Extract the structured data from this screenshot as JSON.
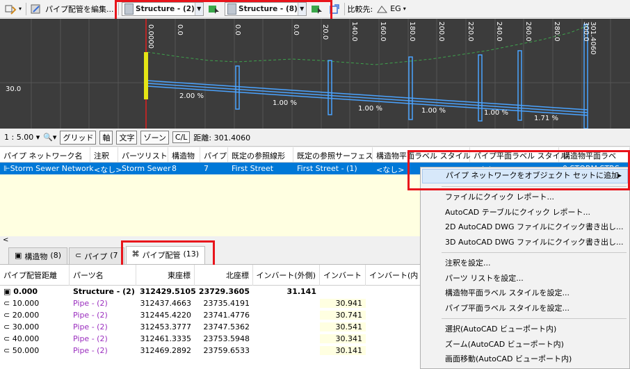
{
  "toolbar": {
    "edit_label": "パイプ配管を編集...",
    "combo1_value": "Structure - (2)",
    "combo2_value": "Structure - (8)",
    "compare_label": "比較先:",
    "compare_value": "EG"
  },
  "profile": {
    "y_label": "30.0",
    "station_labels": [
      "0.0000",
      "0.0",
      "0.0",
      "0.0",
      "20.0",
      "140.0",
      "160.0",
      "180.0",
      "200.0",
      "220.0",
      "240.0",
      "260.0",
      "280.0",
      "300.0",
      "301.4060"
    ],
    "slope_labels": [
      "2.00 %",
      "1.00 %",
      "1.00 %",
      "1.00 %",
      "1.00 %",
      "1.71 %"
    ]
  },
  "statusbar": {
    "scale": "1 : 5.00",
    "buttons": [
      "グリッド",
      "軸",
      "文字",
      "ゾーン",
      "C/L"
    ],
    "distance": "距離: 301.4060"
  },
  "network_grid": {
    "headers": [
      "パイプ ネットワーク名",
      "注釈",
      "パーツリスト",
      "構造物",
      "パイプ",
      "既定の参照線形",
      "既定の参照サーフェス",
      "構造物平面ラベル スタイル",
      "パイプ平面ラベル スタイル",
      "構造物平面ラベ"
    ],
    "row": [
      "Storm Sewer Network",
      "<なし>",
      "Storm Sewer",
      "8",
      "7",
      "First Street",
      "First Street - (1)",
      "<なし>",
      "<なし>",
      "0 STORM STRS"
    ]
  },
  "tabs": [
    {
      "label": "構造物",
      "count": "(8)"
    },
    {
      "label": "パイプ",
      "count": "(7"
    },
    {
      "label": "パイプ配管",
      "count": "(13)"
    }
  ],
  "run_grid": {
    "headers": [
      "パイプ配管距離",
      "パーツ名",
      "東座標",
      "北座標",
      "インバート(外側)",
      "インバート",
      "インバート(内"
    ],
    "rows": [
      {
        "dist": "0.000",
        "part": "Structure - (2)",
        "east": "312429.5105",
        "north": "23729.3605",
        "inv_out": "31.141",
        "inv": ""
      },
      {
        "dist": "10.000",
        "part": "Pipe - (2)",
        "east": "312437.4663",
        "north": "23735.4191",
        "inv_out": "",
        "inv": "30.941"
      },
      {
        "dist": "20.000",
        "part": "Pipe - (2)",
        "east": "312445.4220",
        "north": "23741.4776",
        "inv_out": "",
        "inv": "30.741"
      },
      {
        "dist": "30.000",
        "part": "Pipe - (2)",
        "east": "312453.3777",
        "north": "23747.5362",
        "inv_out": "",
        "inv": "30.541"
      },
      {
        "dist": "40.000",
        "part": "Pipe - (2)",
        "east": "312461.3335",
        "north": "23753.5948",
        "inv_out": "",
        "inv": "30.341"
      },
      {
        "dist": "50.000",
        "part": "Pipe - (2)",
        "east": "312469.2892",
        "north": "23759.6533",
        "inv_out": "",
        "inv": "30.141"
      }
    ]
  },
  "context_menu": {
    "items": [
      "パイプ ネットワークをオブジェクト セットに追加",
      "ファイルにクイック レポート...",
      "AutoCAD テーブルにクイック レポート...",
      "2D AutoCAD DWG ファイルにクイック書き出し...",
      "3D AutoCAD DWG ファイルにクイック書き出し...",
      "注釈を設定...",
      "パーツ リストを設定...",
      "構造物平面ラベル スタイルを設定...",
      "パイプ平面ラベル スタイルを設定...",
      "選択(AutoCAD ビューポート内)",
      "ズーム(AutoCAD ビューポート内)",
      "画面移動(AutoCAD ビューポート内)"
    ]
  },
  "colors": {
    "accent": "#0078d7",
    "highlight_red": "#e8141b",
    "pipe_blue": "#4aa3ff",
    "ground_green": "#3fa34d",
    "structure_purple": "#9b2fbf"
  }
}
